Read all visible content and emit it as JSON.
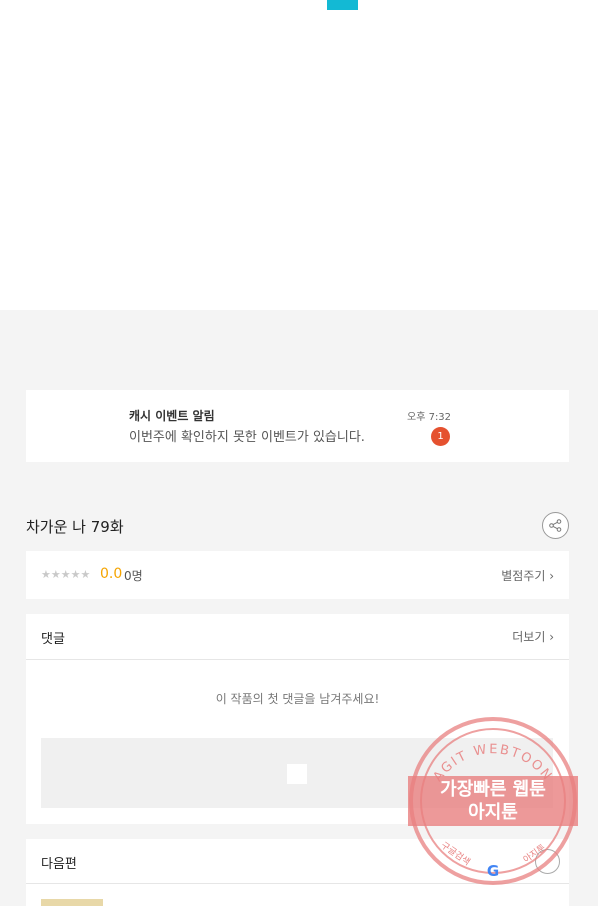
{
  "notification": {
    "title": "캐시 이벤트 알림",
    "message": "이번주에 확인하지 못한 이벤트가 있습니다.",
    "time": "오후 7:32",
    "badge": "1"
  },
  "episode": {
    "title": "차가운 나 79화"
  },
  "rating": {
    "stars": "★★★★★",
    "score": "0.0",
    "count": "0명",
    "action": "별점주기 ›"
  },
  "comments": {
    "title": "댓글",
    "more": "더보기 ›",
    "empty_message": "이 작품의 첫 댓글을 남겨주세요!"
  },
  "next_episode": {
    "title": "다음편"
  },
  "watermark": {
    "ring_text": "AGIT WEBTOON",
    "line1": "가장빠른 웹툰",
    "line2": "아지툰",
    "bottom_left": "구글검색",
    "bottom_right": "아지툰"
  },
  "colors": {
    "accent": "#13b9d4",
    "badge": "#e5512f",
    "score": "#f5a400",
    "watermark": "#e88080"
  }
}
